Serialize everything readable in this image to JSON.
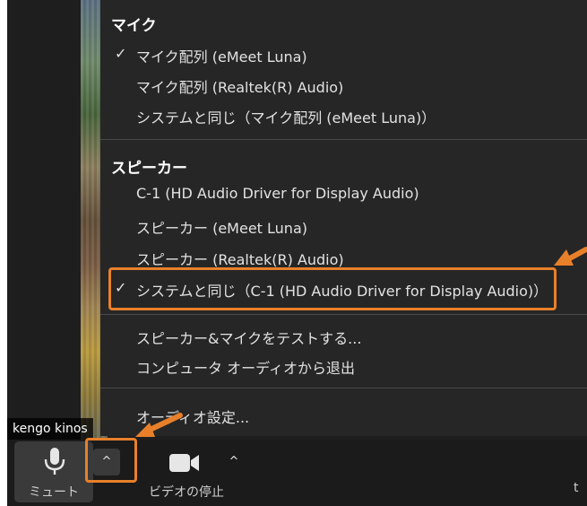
{
  "participant": {
    "name": "kengo kinos"
  },
  "audio_menu": {
    "microphone": {
      "title": "マイク",
      "items": [
        {
          "label": "マイク配列 (eMeet Luna)",
          "checked": true
        },
        {
          "label": "マイク配列 (Realtek(R) Audio)",
          "checked": false
        },
        {
          "label": "システムと同じ（マイク配列 (eMeet Luna)）",
          "checked": false
        }
      ]
    },
    "speaker": {
      "title": "スピーカー",
      "items": [
        {
          "label": "C-1 (HD Audio Driver for Display Audio)",
          "checked": false
        },
        {
          "label": "スピーカー (eMeet Luna)",
          "checked": false
        },
        {
          "label": "スピーカー (Realtek(R) Audio)",
          "checked": false
        },
        {
          "label": "システムと同じ（C-1 (HD Audio Driver for Display Audio)）",
          "checked": true
        }
      ]
    },
    "actions": {
      "test": "スピーカー&マイクをテストする...",
      "leave_audio": "コンピュータ オーディオから退出",
      "settings": "オーディオ設定..."
    },
    "check_glyph": "✓"
  },
  "toolbar": {
    "mute_label": "ミュート",
    "video_label": "ビデオの停止",
    "caret_glyph": "^",
    "cut_label": "t"
  },
  "colors": {
    "highlight": "#e8802a",
    "menu_bg": "#262626",
    "toolbar_bg": "#1b1b1b"
  },
  "icons": [
    "microphone-icon",
    "video-camera-icon",
    "chevron-up-icon",
    "checkmark-icon",
    "annotation-arrow"
  ]
}
